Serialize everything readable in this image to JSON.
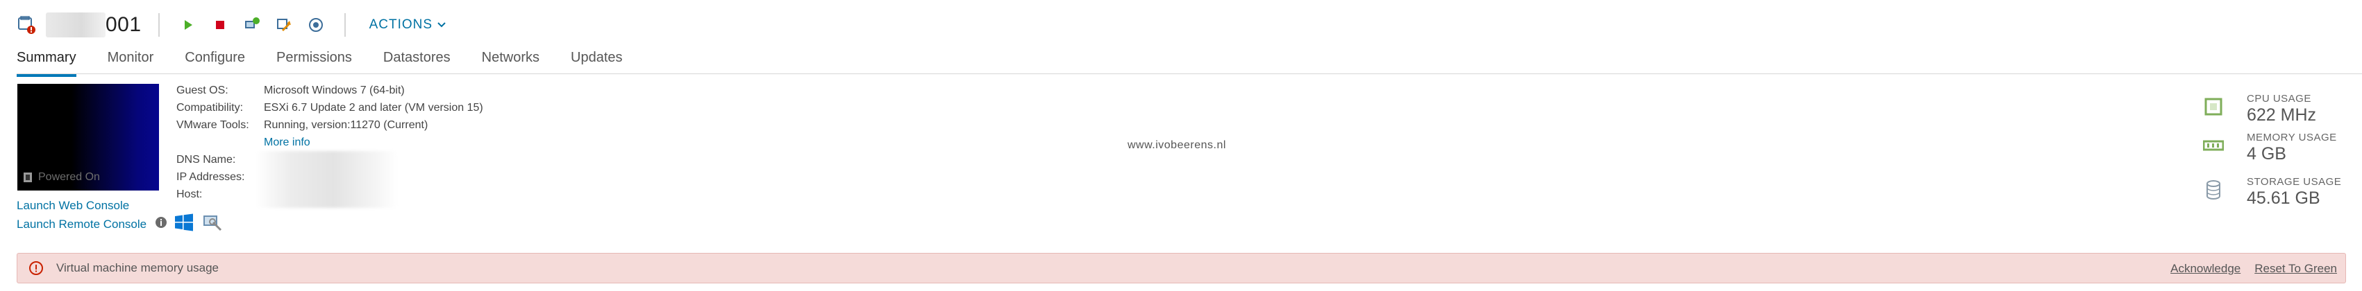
{
  "header": {
    "vm_name_suffix": "001",
    "actions_label": "ACTIONS"
  },
  "tabs": [
    "Summary",
    "Monitor",
    "Configure",
    "Permissions",
    "Datastores",
    "Networks",
    "Updates"
  ],
  "console": {
    "power_state": "Powered On",
    "launch_web_console": "Launch Web Console",
    "launch_remote_console": "Launch Remote Console"
  },
  "details": {
    "guest_os_label": "Guest OS:",
    "guest_os_value": "Microsoft Windows 7 (64-bit)",
    "compatibility_label": "Compatibility:",
    "compatibility_value": "ESXi 6.7 Update 2 and later (VM version 15)",
    "vmware_tools_label": "VMware Tools:",
    "vmware_tools_value": "Running, version:11270 (Current)",
    "more_info": "More info",
    "dns_name_label": "DNS Name:",
    "ip_addresses_label": "IP Addresses:",
    "host_label": "Host:"
  },
  "watermark": "www.ivobeerens.nl",
  "usage": {
    "cpu_label": "CPU USAGE",
    "cpu_value": "622 MHz",
    "memory_label": "MEMORY USAGE",
    "memory_value": "4 GB",
    "storage_label": "STORAGE USAGE",
    "storage_value": "45.61 GB"
  },
  "alert": {
    "message": "Virtual machine memory usage",
    "acknowledge": "Acknowledge",
    "reset": "Reset To Green"
  },
  "colors": {
    "accent": "#0079b8",
    "link": "#0072a3",
    "alert_bg": "#f5dbd9",
    "alert_icon": "#c92100",
    "usage_icon": "#7fae5a"
  }
}
